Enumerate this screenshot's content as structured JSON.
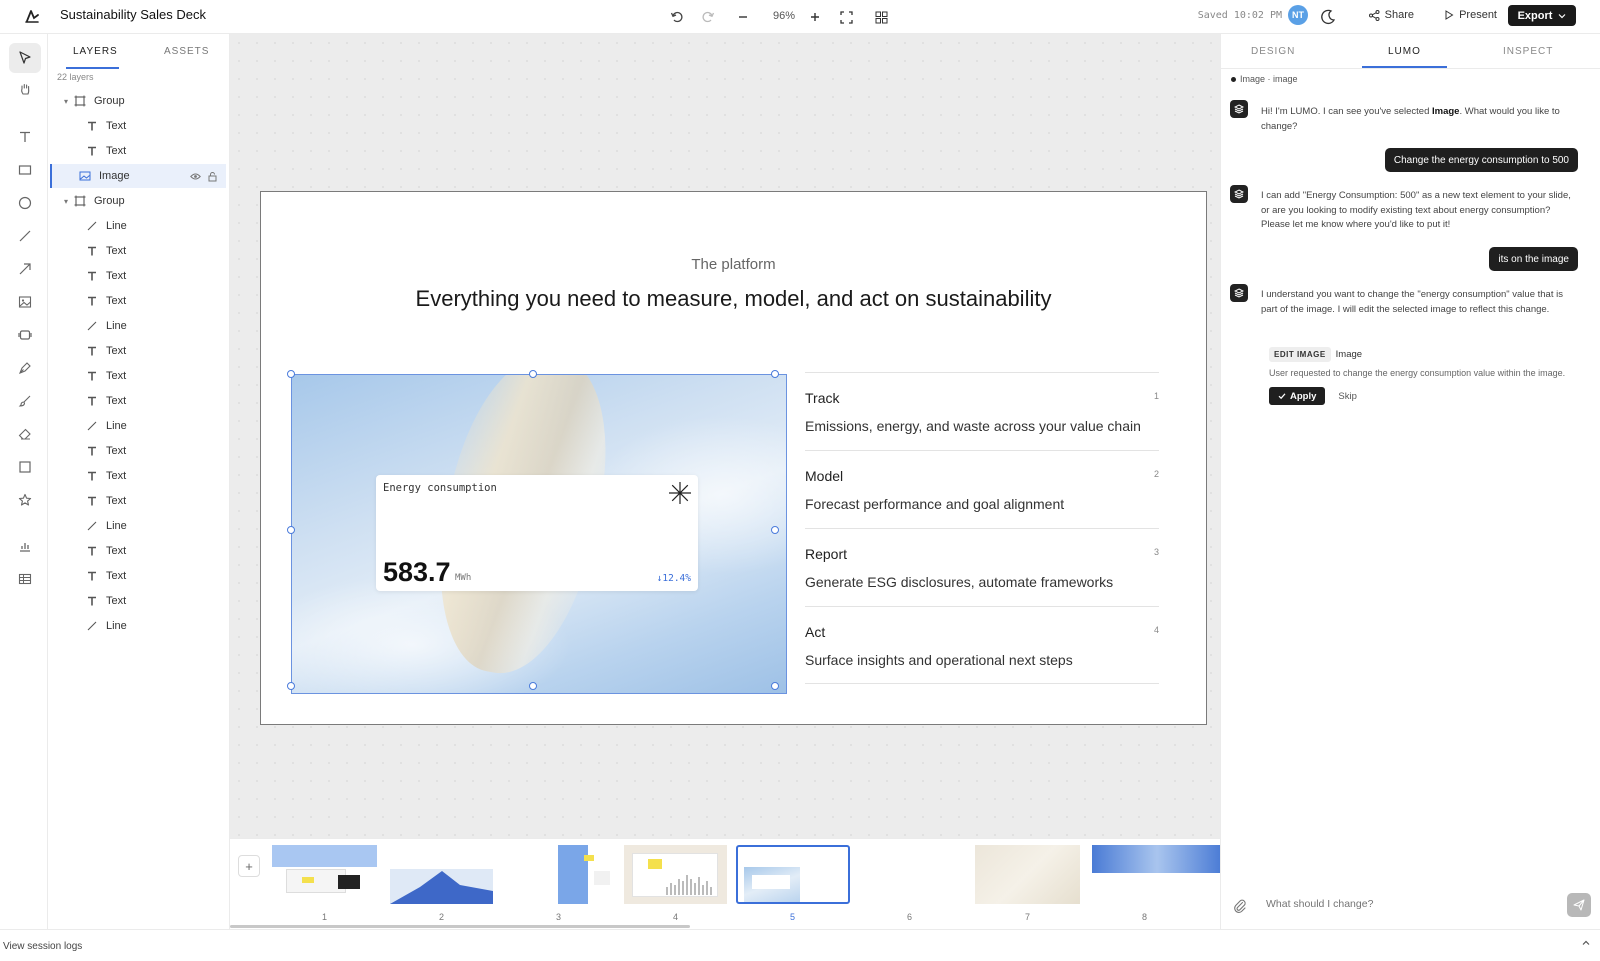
{
  "app": {
    "title": "Sustainability Sales Deck"
  },
  "toolbar": {
    "zoom": "96%",
    "saved": "Saved 10:02 PM",
    "avatar": "NT",
    "share_label": "Share",
    "present_label": "Present",
    "export_label": "Export"
  },
  "layers": {
    "tabs": [
      "LAYERS",
      "ASSETS"
    ],
    "count": "22 layers",
    "items": [
      {
        "label": "Group",
        "kind": "group"
      },
      {
        "label": "Text",
        "kind": "text"
      },
      {
        "label": "Text",
        "kind": "text"
      },
      {
        "label": "Image",
        "kind": "image"
      },
      {
        "label": "Group",
        "kind": "group"
      },
      {
        "label": "Line",
        "kind": "line"
      },
      {
        "label": "Text",
        "kind": "text"
      },
      {
        "label": "Text",
        "kind": "text"
      },
      {
        "label": "Text",
        "kind": "text"
      },
      {
        "label": "Line",
        "kind": "line"
      },
      {
        "label": "Text",
        "kind": "text"
      },
      {
        "label": "Text",
        "kind": "text"
      },
      {
        "label": "Text",
        "kind": "text"
      },
      {
        "label": "Line",
        "kind": "line"
      },
      {
        "label": "Text",
        "kind": "text"
      },
      {
        "label": "Text",
        "kind": "text"
      },
      {
        "label": "Text",
        "kind": "text"
      },
      {
        "label": "Line",
        "kind": "line"
      },
      {
        "label": "Text",
        "kind": "text"
      },
      {
        "label": "Text",
        "kind": "text"
      },
      {
        "label": "Text",
        "kind": "text"
      },
      {
        "label": "Line",
        "kind": "line"
      }
    ]
  },
  "slide": {
    "eyebrow": "The platform",
    "headline": "Everything you need to measure, model, and act on sustainability",
    "card": {
      "label": "Energy consumption",
      "value": "583.7",
      "unit": "MWh",
      "delta": "↓12.4%"
    },
    "features": [
      {
        "title": "Track",
        "num": "1",
        "desc": "Emissions, energy, and waste across your value chain"
      },
      {
        "title": "Model",
        "num": "2",
        "desc": "Forecast performance and goal alignment"
      },
      {
        "title": "Report",
        "num": "3",
        "desc": "Generate ESG disclosures, automate frameworks"
      },
      {
        "title": "Act",
        "num": "4",
        "desc": "Surface insights and operational next steps"
      }
    ]
  },
  "filmstrip": {
    "add_label": "+",
    "slides": [
      "1",
      "2",
      "3",
      "4",
      "5",
      "6",
      "7",
      "8"
    ],
    "selected": "5"
  },
  "right_panel": {
    "tabs": [
      "DESIGN",
      "LUMO",
      "INSPECT"
    ],
    "context": "Image · image",
    "messages": {
      "bot1_pre": "Hi! I'm LUMO. I can see you've selected ",
      "bot1_bold": "Image",
      "bot1_post": ". What would you like to change?",
      "user1": "Change the energy consumption to 500",
      "bot2": "I can add \"Energy Consumption: 500\" as a new text element to your slide, or are you looking to modify existing text about energy consumption? Please let me know where you'd like to put it!",
      "user2": "its on the image",
      "bot3": "I understand you want to change the \"energy consumption\" value that is part of the image. I will edit the selected image to reflect this change."
    },
    "action": {
      "tag": "EDIT IMAGE",
      "target": "Image",
      "desc": "User requested to change the energy consumption value within the image.",
      "apply_label": "Apply",
      "skip_label": "Skip"
    },
    "input_placeholder": "What should I change?"
  },
  "footer": {
    "session_logs": "View session logs"
  },
  "colors": {
    "accent": "#3b6fd9",
    "dark": "#1f1f1f",
    "avatar": "#5aa0e6"
  }
}
